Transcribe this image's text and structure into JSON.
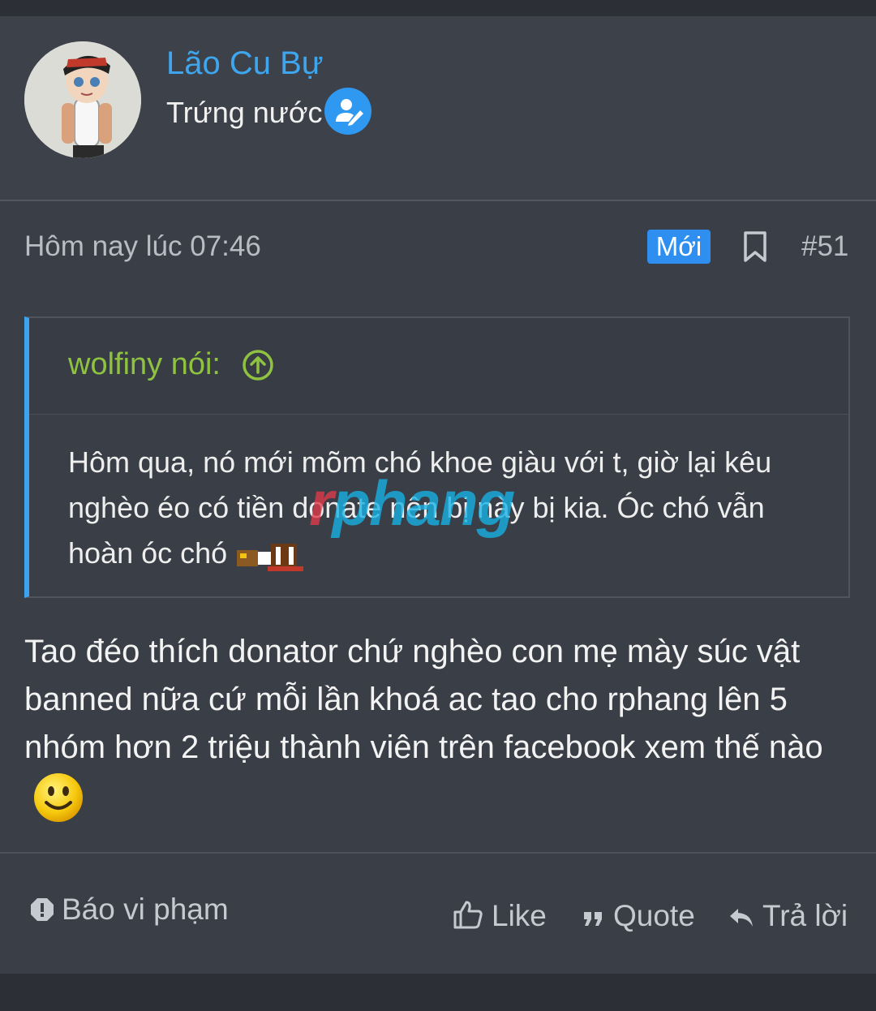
{
  "user": {
    "name": "Lão Cu Bự",
    "title": "Trứng nước"
  },
  "post": {
    "date": "Hôm nay lúc 07:46",
    "new_badge": "Mới",
    "number": "#51"
  },
  "quote": {
    "author": "wolfiny nói:",
    "text": "Hôm qua, nó mới mõm chó khoe giàu với t, giờ lại kêu nghèo éo có tiền donate nên bị này bị kia. Óc chó vẫn hoàn óc chó"
  },
  "message": "Tao đéo thích donator chứ nghèo con mẹ mày súc vật banned nữa cứ mỗi lần khoá ac tao cho rphang lên 5 nhóm hơn 2 triệu thành viên trên facebook xem thế nào",
  "actions": {
    "report": "Báo vi phạm",
    "like": "Like",
    "quote": "Quote",
    "reply": "Trả lời"
  },
  "watermark": {
    "r": "r",
    "rest": "phang"
  }
}
